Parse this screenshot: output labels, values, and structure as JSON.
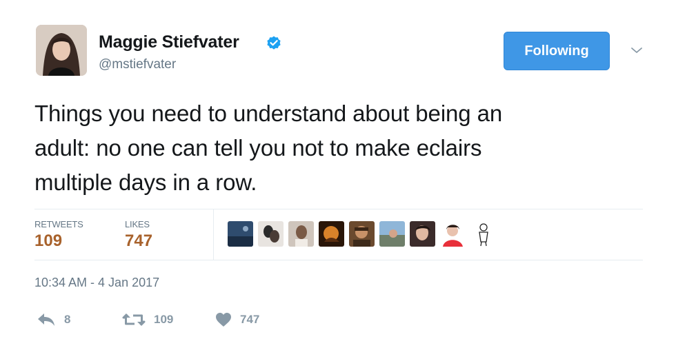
{
  "author": {
    "name": "Maggie Stiefvater",
    "handle": "@mstiefvater",
    "verified": true
  },
  "follow_button": {
    "label": "Following"
  },
  "tweet": {
    "lines": [
      "Things you need to understand about being an",
      "adult: no one can tell you not to make eclairs",
      "multiple days in a row."
    ]
  },
  "stats": {
    "retweets_label": "RETWEETS",
    "retweets": "109",
    "likes_label": "LIKES",
    "likes": "747"
  },
  "likers_count": 9,
  "timestamp": "10:34 AM - 4 Jan 2017",
  "actions": {
    "reply_count": "8",
    "retweet_count": "109",
    "like_count": "747"
  },
  "colors": {
    "accent": "#3f97e6",
    "stat_value": "#a8622c",
    "muted": "#657786",
    "icon": "#8899a6"
  },
  "icons": {
    "verified": "verified-badge-icon",
    "dropdown": "chevron-down-icon",
    "reply": "reply-icon",
    "retweet": "retweet-icon",
    "like": "heart-icon"
  }
}
